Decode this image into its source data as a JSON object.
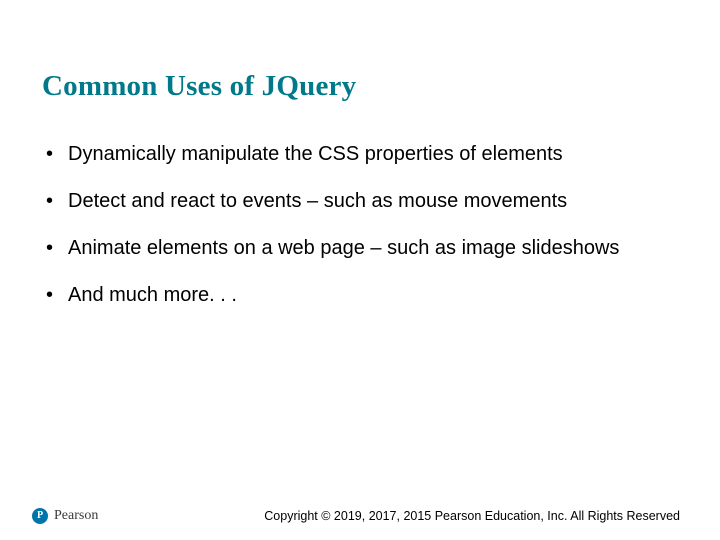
{
  "title": "Common Uses of JQuery",
  "bullets": [
    "Dynamically manipulate the CSS properties of elements",
    "Detect and react to events – such as mouse movements",
    "Animate elements on a web page – such as image slideshows",
    "And much more. . ."
  ],
  "footer": {
    "logo_letter": "P",
    "logo_text": "Pearson",
    "copyright": "Copyright © 2019, 2017, 2015 Pearson Education, Inc. All Rights Reserved"
  }
}
